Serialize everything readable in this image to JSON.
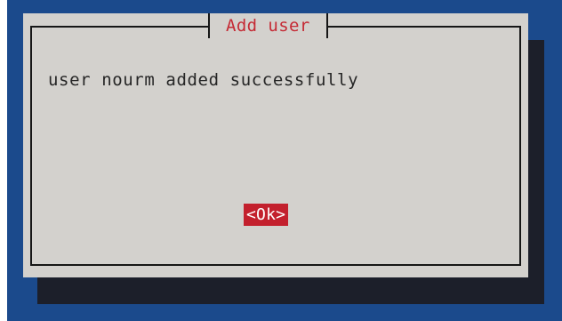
{
  "dialog": {
    "title": "Add user",
    "message": "user nourm added successfully",
    "ok_button": {
      "open": "<",
      "hotkey": "O",
      "rest": "k",
      "close": ">"
    }
  },
  "colors": {
    "background": "#1b4a8c",
    "dialog": "#d3d1cd",
    "shadow": "#1c1f2a",
    "title": "#c52b35",
    "button": "#c3202d"
  }
}
